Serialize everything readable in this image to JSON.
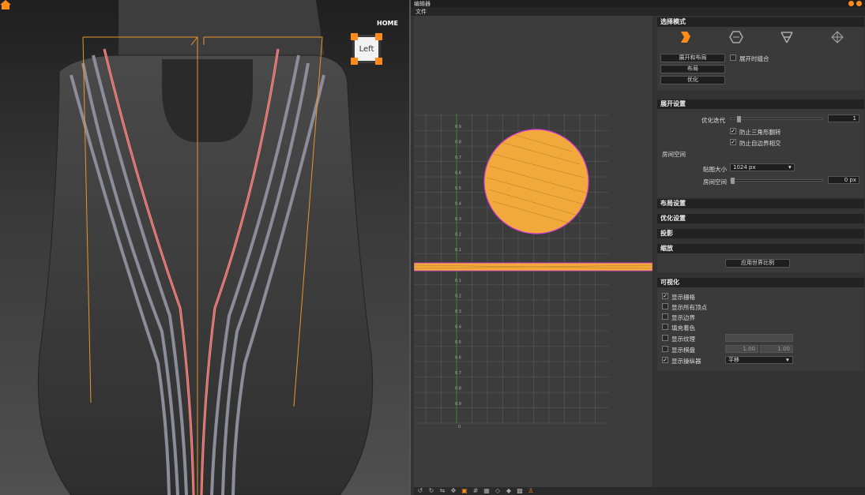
{
  "viewport": {
    "view_cube_label": "Left",
    "home_label": "HOME"
  },
  "editor": {
    "title": "编辑器",
    "menu": {
      "file": "文件"
    }
  },
  "uv_axis": {
    "y_ticks_upper": [
      "0.9",
      "0.8",
      "0.7",
      "0.6",
      "0.5",
      "0.4",
      "0.3",
      "0.2",
      "0.1"
    ],
    "y_ticks_lower": [
      "0.1",
      "0.2",
      "0.3",
      "0.4",
      "0.5",
      "0.6",
      "0.7",
      "0.8",
      "0.9"
    ],
    "zero_label": "0"
  },
  "select_mode": {
    "title": "选择模式",
    "buttons": {
      "unfold_pack": "展开和布局",
      "layout": "布局",
      "optimize": "优化"
    },
    "stitch_on_unfold": "展开时缝合"
  },
  "unfold_settings": {
    "title": "展开设置",
    "opt_iterations_label": "优化迭代",
    "opt_iterations_value": "1",
    "prevent_triangle_flip": "防止三角形翻转",
    "prevent_self_intersect": "防止自边界相交",
    "spacing_group": "房间空间",
    "map_size_label": "贴图大小",
    "map_size_value": "1024 px",
    "room_space_label": "房间空间",
    "room_space_value": "0 px"
  },
  "layout_settings": {
    "title": "布局设置"
  },
  "optimize_settings": {
    "title": "优化设置"
  },
  "projection": {
    "title": "投影"
  },
  "scale": {
    "title": "缩放",
    "apply_world_scale": "应用世界比例"
  },
  "visualization": {
    "title": "可视化",
    "show_grid": "显示栅格",
    "show_all_vertices": "显示所有顶点",
    "show_border": "显示边界",
    "fill_color": "填充着色",
    "show_texture": "显示纹理",
    "show_checker": "显示棋盘",
    "checker_u": "1.00",
    "checker_v": "1.00",
    "show_manipulator": "显示操纵器",
    "manipulator_mode": "平移"
  },
  "colors": {
    "accent": "#ff8c1a",
    "uv_fill": "#f2a93b",
    "uv_border": "#d63ad6",
    "grid_line": "#5a5a5a"
  }
}
